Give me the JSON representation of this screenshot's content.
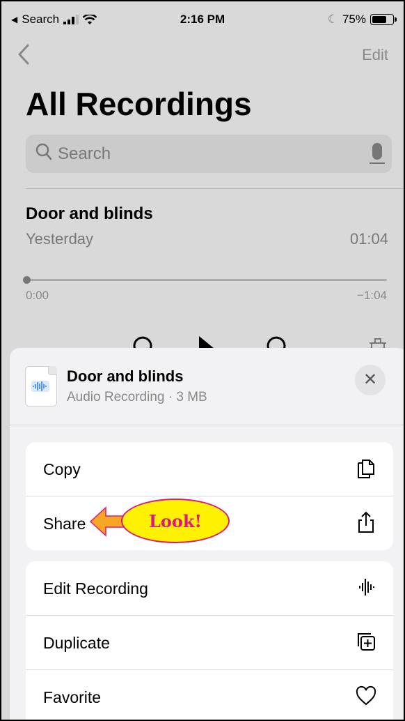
{
  "status_bar": {
    "back_app": "Search",
    "time": "2:16 PM",
    "battery_percent": "75%",
    "battery_level": 0.75
  },
  "nav": {
    "back_icon": "chevron-left-icon",
    "edit_label": "Edit"
  },
  "page": {
    "title": "All Recordings"
  },
  "search": {
    "placeholder": "Search",
    "icons": [
      "search-icon",
      "microphone-icon"
    ]
  },
  "recording": {
    "title": "Door and blinds",
    "date": "Yesterday",
    "duration": "01:04",
    "time_start": "0:00",
    "time_remaining": "−1:04",
    "progress": 0
  },
  "sheet": {
    "file_name": "Door and blinds",
    "file_subtitle": "Audio Recording · 3 MB",
    "close_icon": "close-icon",
    "actions_group1": [
      {
        "label": "Copy",
        "icon": "copy-icon"
      },
      {
        "label": "Share",
        "icon": "share-icon"
      }
    ],
    "actions_group2": [
      {
        "label": "Edit Recording",
        "icon": "waveform-icon"
      },
      {
        "label": "Duplicate",
        "icon": "duplicate-icon"
      },
      {
        "label": "Favorite",
        "icon": "heart-icon"
      }
    ]
  },
  "annotation": {
    "text": "Look!"
  },
  "colors": {
    "accent_annotation": "#e0187a",
    "annotation_fill": "#fff200",
    "background_dim": "#d9d9d9"
  }
}
